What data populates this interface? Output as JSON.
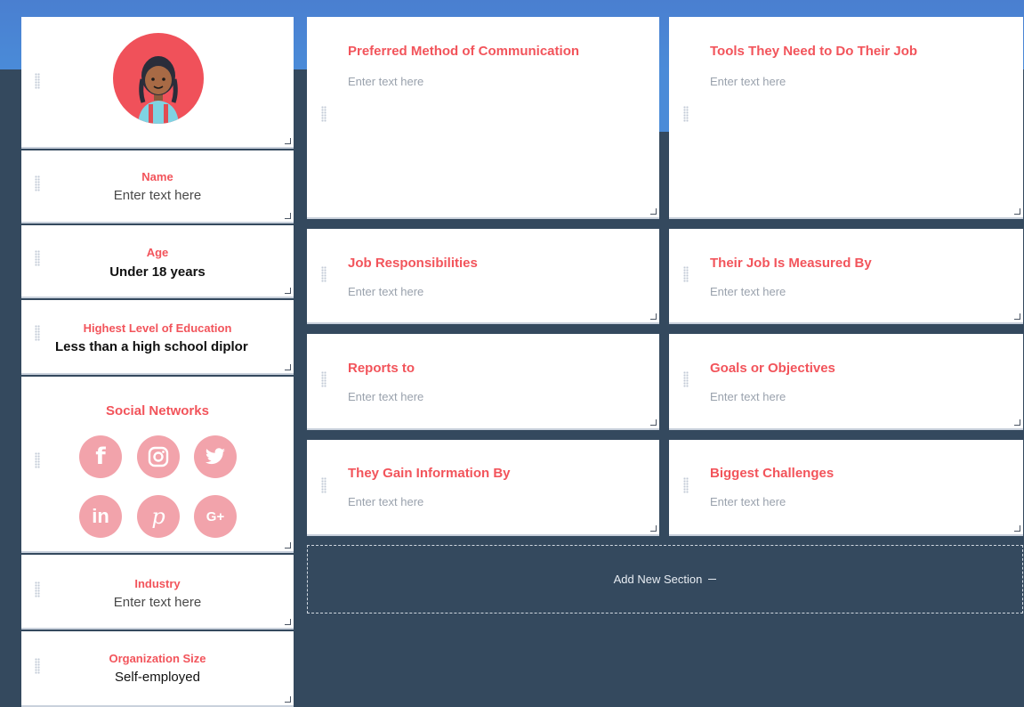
{
  "profile": {
    "fields": [
      {
        "title": "Name",
        "value": "Enter text here"
      },
      {
        "title": "Age",
        "value": "Under 18 years"
      },
      {
        "title": "Highest Level of Education",
        "value": "Less than a high school diplor"
      },
      {
        "title": "Industry",
        "value": "Enter text here"
      },
      {
        "title": "Organization Size",
        "value": "Self-employed"
      }
    ],
    "social": {
      "title": "Social Networks",
      "icons": [
        "facebook-icon",
        "instagram-icon",
        "twitter-icon",
        "linkedin-icon",
        "pinterest-icon",
        "google-plus-icon"
      ]
    },
    "avatar": "persona-avatar"
  },
  "sections": [
    {
      "title": "Preferred Method of Communication",
      "value": "Enter text here"
    },
    {
      "title": "Tools They Need to Do Their Job",
      "value": "Enter text here"
    },
    {
      "title": "Job Responsibilities",
      "value": "Enter text here"
    },
    {
      "title": "Their Job Is Measured By",
      "value": "Enter text here"
    },
    {
      "title": "Reports to",
      "value": "Enter text here"
    },
    {
      "title": "Goals or Objectives",
      "value": "Enter text here"
    },
    {
      "title": "They Gain Information By",
      "value": "Enter text here"
    },
    {
      "title": "Biggest Challenges",
      "value": "Enter text here"
    }
  ],
  "add_section": {
    "label": "Add New Section",
    "icon": "minus-icon"
  },
  "colors": {
    "accent": "#f2545b",
    "background": "#34495e",
    "header": "#4a8bd8",
    "social": "#f2a3ab"
  }
}
